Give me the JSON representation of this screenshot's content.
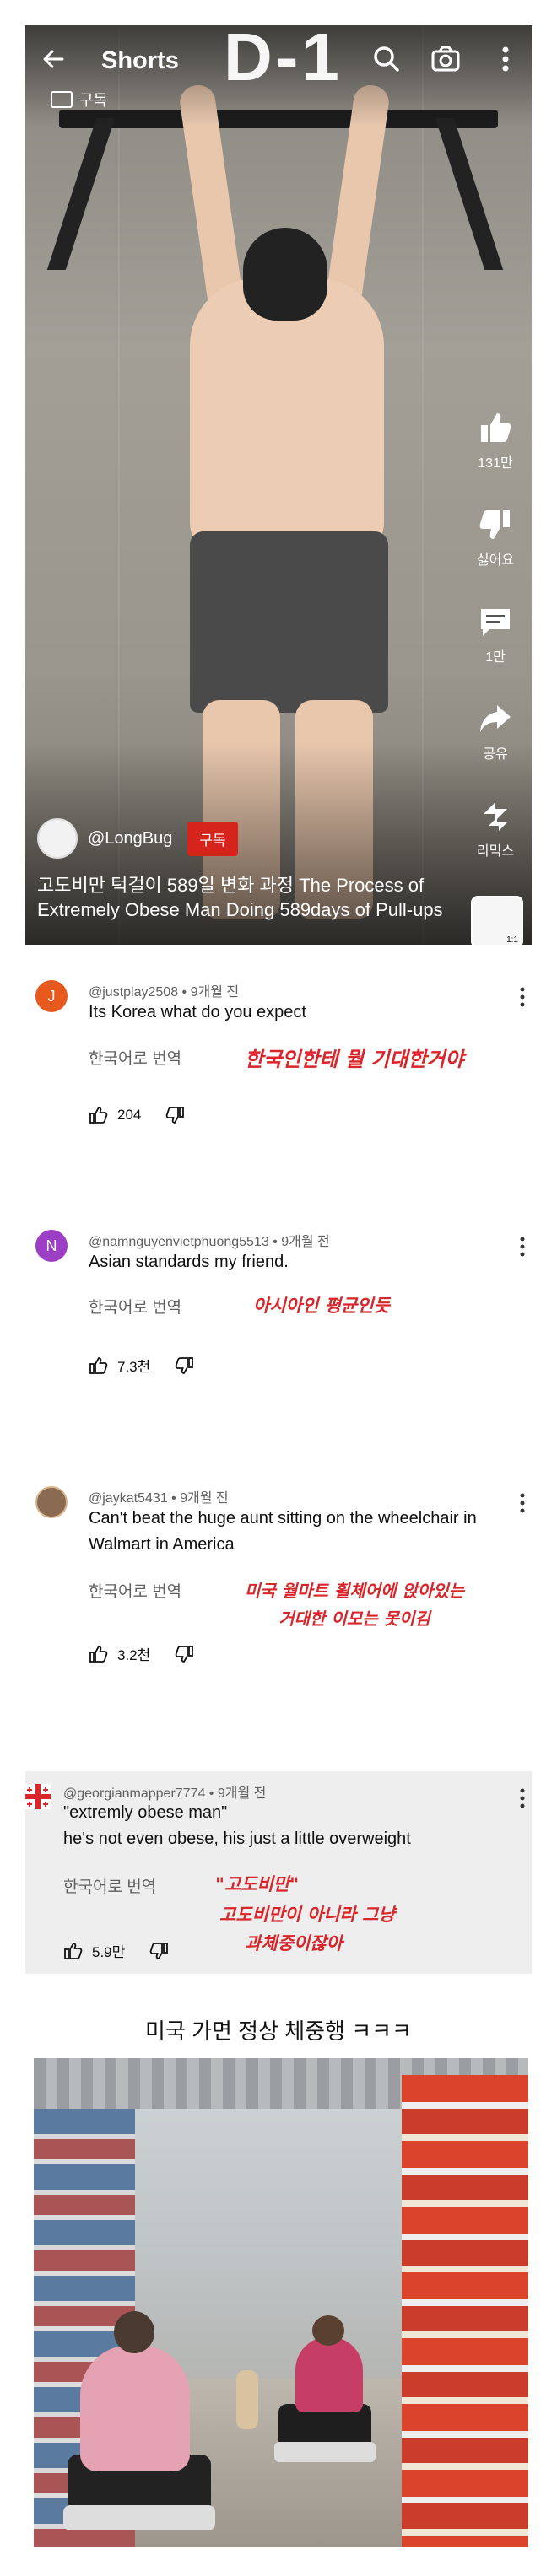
{
  "shorts": {
    "title": "Shorts",
    "bg_letters": "D-1",
    "subscribe_chip": "구독",
    "actions": {
      "like_count": "131만",
      "dislike_label": "싫어요",
      "comment_count": "1만",
      "share_label": "공유",
      "remix_label": "리믹스"
    },
    "channel": {
      "name": "@LongBug",
      "subscribe": "구독"
    },
    "video_title": "고도비만 턱걸이 589일 변화 과정 The Process of Extremely Obese Man Doing 589days of Pull-ups",
    "remix_thumb_text": "1:1"
  },
  "comments": [
    {
      "avatar_letter": "J",
      "avatar_color": "#e8591d",
      "meta": "@justplay2508 • 9개월 전",
      "text": "Its Korea what do you expect",
      "translate_label": "한국어로 번역",
      "red_note": "한국인한테 뭘 기대한거야",
      "likes": "204"
    },
    {
      "avatar_letter": "N",
      "avatar_color": "#9c3fc4",
      "meta": "@namnguyenvietphuong5513 • 9개월 전",
      "text": "Asian standards my friend.",
      "translate_label": "한국어로 번역",
      "red_note": "아시아인 평균인듯",
      "likes": "7.3천"
    },
    {
      "avatar_letter": "",
      "avatar_color": "#8a6a50",
      "meta": "@jaykat5431 • 9개월 전",
      "text": "Can't beat the huge aunt sitting on the wheelchair in Walmart in America",
      "translate_label": "한국어로 번역",
      "red_note_line1": "미국 월마트 휠체어에 앉아있는",
      "red_note_line2": "거대한 이모는 못이김",
      "likes": "3.2천"
    },
    {
      "avatar_letter": "",
      "avatar_color": "#ffffff",
      "meta": "@georgianmapper7774 • 9개월 전",
      "text_line1": "\"extremly obese man\"",
      "text_line2": "he's not even obese, his just a little overweight",
      "translate_label": "한국어로 번역",
      "red_note_line1": "\"고도비만\"",
      "red_note_line2": "고도비만이 아니라 그냥",
      "red_note_line3": "과체중이잖아",
      "likes": "5.9만"
    }
  ],
  "caption": "미국 가면 정상 체중행 ㅋㅋㅋ",
  "colors": {
    "accent_red": "#d8262a",
    "subscribe_red": "#d6231c"
  }
}
